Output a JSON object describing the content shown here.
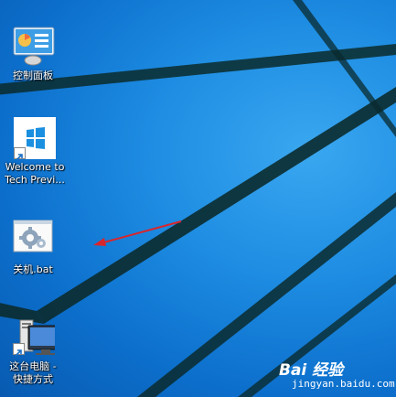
{
  "desktop": {
    "icons": [
      {
        "label": "控制面板",
        "icon": "control-panel-icon"
      },
      {
        "label": "Welcome to\nTech Previ...",
        "icon": "windows-logo-icon"
      },
      {
        "label": "关机.bat",
        "icon": "batch-file-icon"
      },
      {
        "label": "这台电脑 -\n快捷方式",
        "icon": "this-pc-icon"
      }
    ]
  },
  "watermark": {
    "logo": "Bai  经验",
    "url": "jingyan.baidu.com"
  },
  "colors": {
    "desktop_blue": "#1f8ee3",
    "annotation_arrow": "#d8262c",
    "windows_tile": "#1a8fe0"
  }
}
